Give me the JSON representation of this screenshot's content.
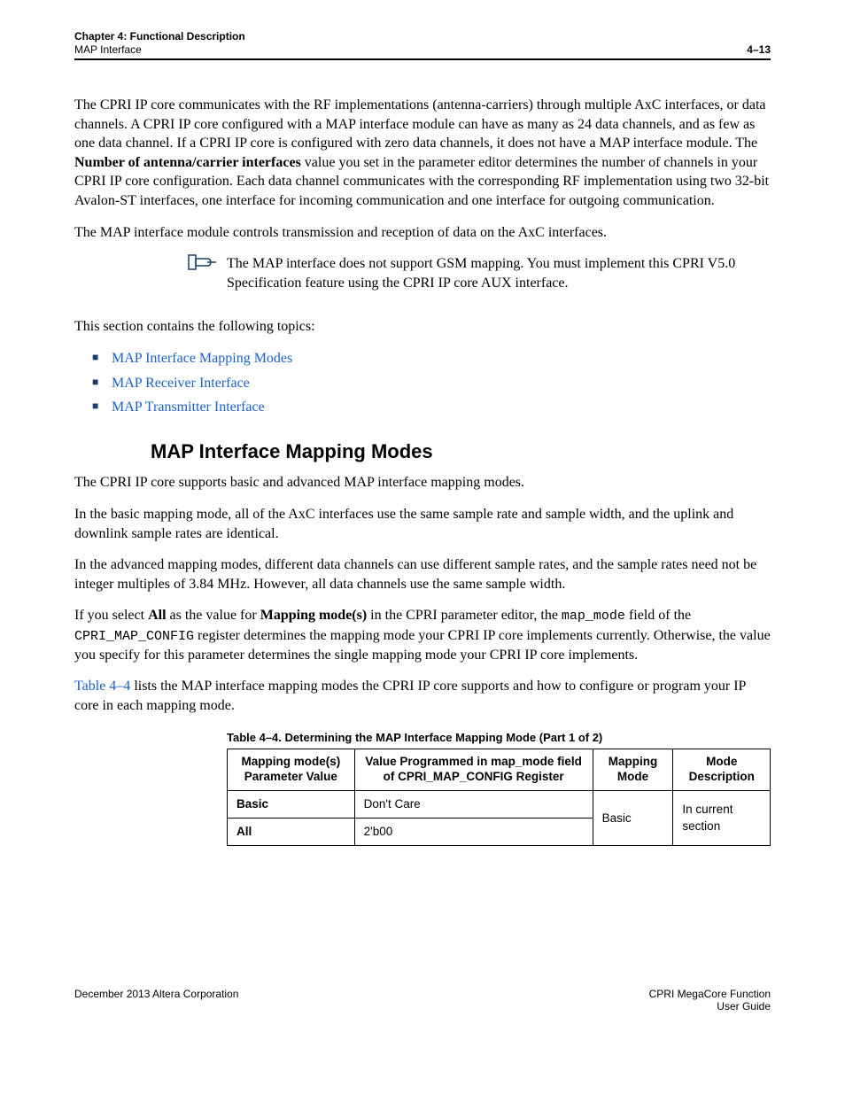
{
  "header": {
    "chapter": "Chapter 4:  Functional Description",
    "sub": "MAP Interface",
    "pagenum": "4–13"
  },
  "para1_a": "The CPRI IP core communicates with the RF implementations (antenna-carriers) through multiple AxC interfaces, or data channels. A CPRI IP core configured with a MAP interface module can have as many as 24 data channels, and as few as one data channel. If a CPRI IP core is configured with zero data channels, it does not have a MAP interface module. The ",
  "para1_b": "Number of antenna/carrier interfaces",
  "para1_c": " value you set in the parameter editor determines the number of channels in your CPRI IP core configuration. Each data channel communicates with the corresponding RF implementation using two 32-bit Avalon-ST interfaces, one interface for incoming communication and one interface for outgoing communication.",
  "para2": "The MAP interface module controls transmission and reception of data on the AxC interfaces.",
  "note": "The MAP interface does not support GSM mapping. You must implement this CPRI V5.0 Specification feature using the CPRI IP core AUX interface.",
  "topics_intro": "This section contains the following topics:",
  "topics": [
    "MAP Interface Mapping Modes",
    "MAP Receiver Interface",
    "MAP Transmitter Interface"
  ],
  "h2": "MAP Interface Mapping Modes",
  "p3": "The CPRI IP core supports basic and advanced MAP interface mapping modes.",
  "p4": "In the basic mapping mode, all of the AxC interfaces use the same sample rate and sample width, and the uplink and downlink sample rates are identical.",
  "p5": "In the advanced mapping modes, different data channels can use different sample rates, and the sample rates need not be integer multiples of 3.84 MHz. However, all data channels use the same sample width.",
  "p6_a": "If you select ",
  "p6_all": "All",
  "p6_b": " as the value for ",
  "p6_mm": "Mapping mode(s)",
  "p6_c": " in the CPRI parameter editor, the ",
  "p6_field": "map_mode",
  "p6_d": " field of the ",
  "p6_reg": "CPRI_MAP_CONFIG",
  "p6_e": " register determines the mapping mode your CPRI IP core implements currently. Otherwise, the value you specify for this parameter determines the single mapping mode your CPRI IP core implements.",
  "p7_a": "Table 4–4",
  "p7_b": " lists the MAP interface mapping modes the CPRI IP core supports and how to configure or program your IP core in each mapping mode.",
  "table_caption": "Table 4–4.  Determining the MAP Interface Mapping Mode   (Part 1 of 2)",
  "table": {
    "headers": [
      "Mapping mode(s) Parameter Value",
      "Value Programmed in map_mode field of CPRI_MAP_CONFIG Register",
      "Mapping Mode",
      "Mode Description"
    ],
    "rows": [
      {
        "c0": "Basic",
        "c1": "Don't Care",
        "c2": "Basic",
        "c3": "In current section"
      },
      {
        "c0": "All",
        "c1": "2'b00"
      }
    ]
  },
  "footer": {
    "left": "December 2013    Altera Corporation",
    "right1": "CPRI MegaCore Function",
    "right2": "User Guide"
  }
}
